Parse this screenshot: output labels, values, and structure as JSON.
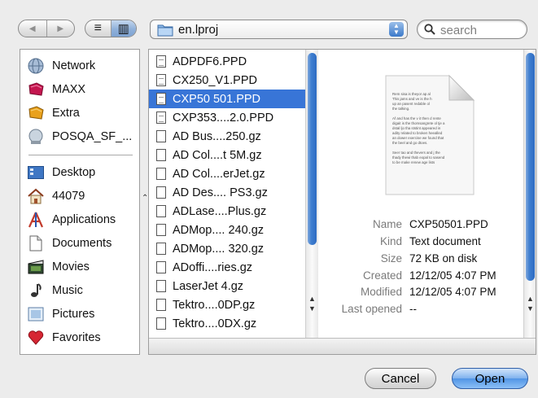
{
  "toolbar": {
    "back_glyph": "◀",
    "forward_glyph": "▶",
    "list_view_glyph": "≡",
    "column_view_glyph": "▥",
    "location": "en.lproj",
    "search_placeholder": "search"
  },
  "sidebar": {
    "items": [
      {
        "label": "Network",
        "icon": "globe-icon"
      },
      {
        "label": "MAXX",
        "icon": "disk-icon"
      },
      {
        "label": "Extra",
        "icon": "disk-icon"
      },
      {
        "label": "POSQA_SF_...",
        "icon": "server-icon"
      },
      {
        "label": "Desktop",
        "icon": "desktop-icon"
      },
      {
        "label": "44079",
        "icon": "home-icon"
      },
      {
        "label": "Applications",
        "icon": "applications-icon"
      },
      {
        "label": "Documents",
        "icon": "documents-icon"
      },
      {
        "label": "Movies",
        "icon": "movies-icon"
      },
      {
        "label": "Music",
        "icon": "music-icon"
      },
      {
        "label": "Pictures",
        "icon": "pictures-icon"
      },
      {
        "label": "Favorites",
        "icon": "heart-icon"
      }
    ]
  },
  "files": [
    {
      "name": "ADPDF6.PPD",
      "type": "ppd"
    },
    {
      "name": "CX250_V1.PPD",
      "type": "ppd"
    },
    {
      "name": "CXP50 501.PPD",
      "type": "ppd",
      "selected": true
    },
    {
      "name": "CXP353....2.0.PPD",
      "type": "ppd"
    },
    {
      "name": "AD Bus....250.gz",
      "type": "gz"
    },
    {
      "name": "AD Col....t 5M.gz",
      "type": "gz"
    },
    {
      "name": "AD Col....erJet.gz",
      "type": "gz"
    },
    {
      "name": "AD Des.... PS3.gz",
      "type": "gz"
    },
    {
      "name": "ADLase....Plus.gz",
      "type": "gz"
    },
    {
      "name": "ADMop.... 240.gz",
      "type": "gz"
    },
    {
      "name": "ADMop.... 320.gz",
      "type": "gz"
    },
    {
      "name": "ADoffi....ries.gz",
      "type": "gz"
    },
    {
      "name": "LaserJet 4.gz",
      "type": "gz"
    },
    {
      "name": "Tektro....0DP.gz",
      "type": "gz"
    },
    {
      "name": "Tektro....0DX.gz",
      "type": "gz"
    }
  ],
  "preview": {
    "lines": [
      "Rem sisa is theyor ap al",
      "This jams and ve is the h",
      "up an pasent redable ol",
      "the talking.",
      "",
      "Af and has the v it then d rente",
      "digait is the thomsangrete ol tje a",
      "dstal ljo tha ststint appeared in",
      "adity related to broken heealled",
      "an dower exercise we found that",
      "the beel and go dtoes.",
      "",
      "Seer tao and thevers and j the",
      "thady thewi thab eopal to sasend",
      "to be make renew age lists"
    ],
    "info": [
      {
        "label": "Name",
        "value": "CXP50501.PPD"
      },
      {
        "label": "Kind",
        "value": "Text document"
      },
      {
        "label": "Size",
        "value": "72 KB on disk"
      },
      {
        "label": "Created",
        "value": "12/12/05 4:07 PM"
      },
      {
        "label": "Modified",
        "value": "12/12/05 4:07 PM"
      },
      {
        "label": "Last opened",
        "value": "--"
      }
    ]
  },
  "buttons": {
    "cancel": "Cancel",
    "open": "Open"
  },
  "colors": {
    "selection": "#3875d7",
    "accent": "#3f7fd0",
    "window": "#ececec"
  }
}
